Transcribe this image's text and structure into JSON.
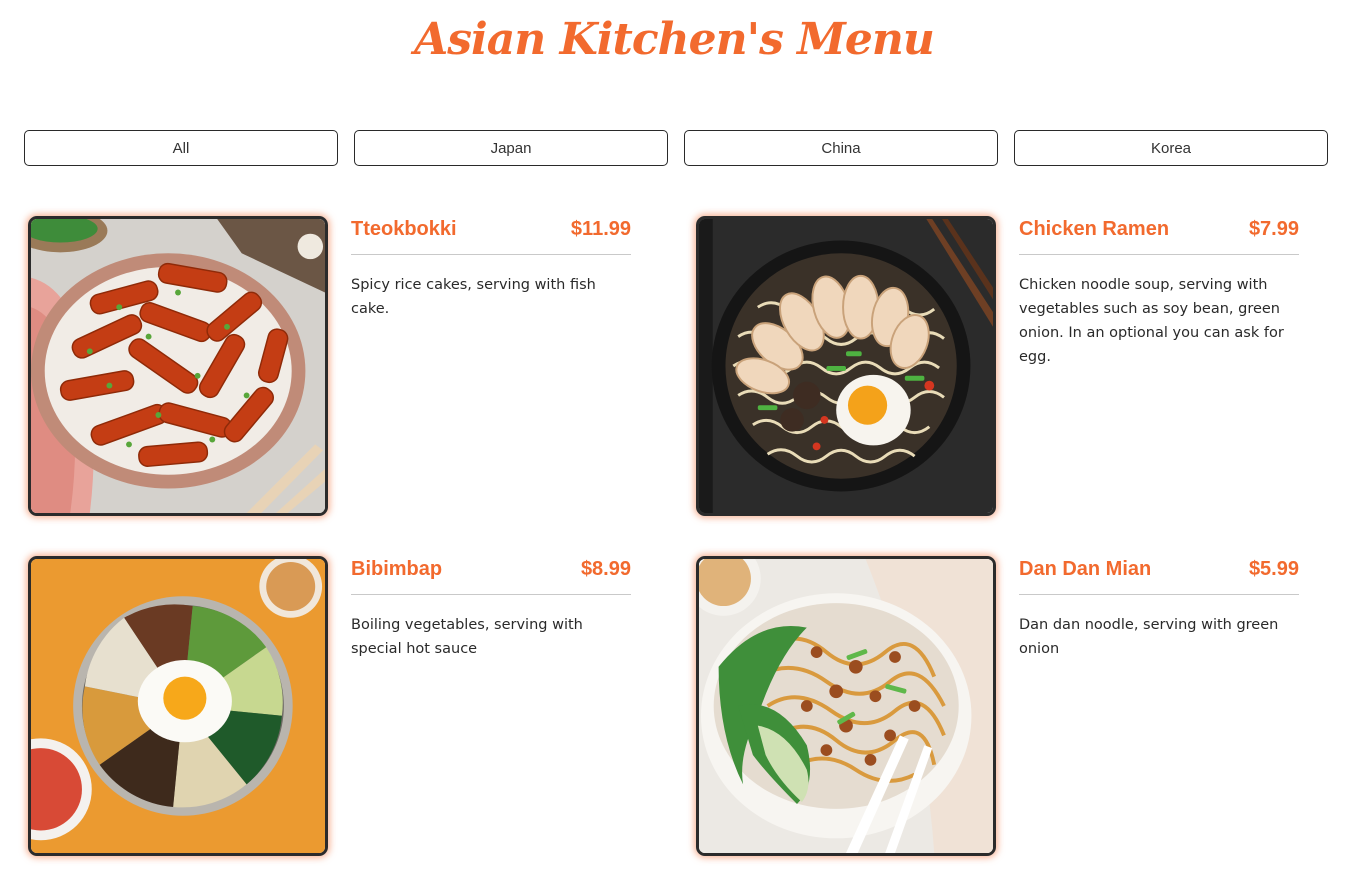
{
  "header": {
    "title": "Asian Kitchen's Menu"
  },
  "filters": [
    "All",
    "Japan",
    "China",
    "Korea"
  ],
  "menu": [
    {
      "name": "Tteokbokki",
      "price": "$11.99",
      "desc": "Spicy rice cakes, serving with fish cake."
    },
    {
      "name": "Chicken Ramen",
      "price": "$7.99",
      "desc": "Chicken noodle soup, serving with vegetables such as soy bean, green onion. In an optional you can ask for egg."
    },
    {
      "name": "Bibimbap",
      "price": "$8.99",
      "desc": "Boiling vegetables, serving with special hot sauce"
    },
    {
      "name": "Dan Dan Mian",
      "price": "$5.99",
      "desc": "Dan dan noodle, serving with green onion"
    }
  ],
  "colors": {
    "accent": "#f26a2e",
    "border": "#2b2b2b",
    "glow": "#f27a46"
  }
}
